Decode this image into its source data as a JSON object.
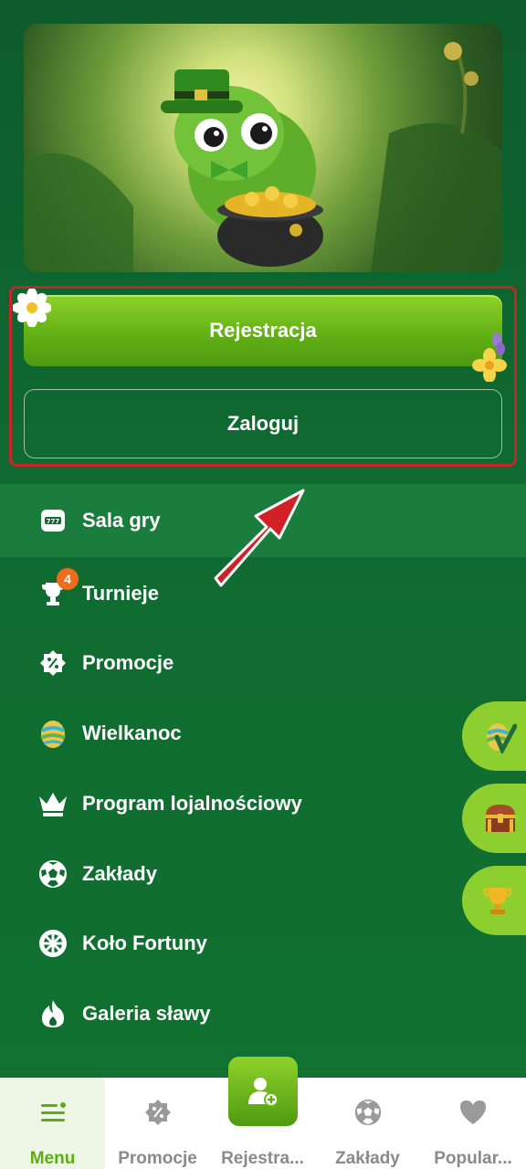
{
  "banner": {
    "alt_icon": "leprechaun-pot-of-gold-banner"
  },
  "auth": {
    "register_label": "Rejestracja",
    "login_label": "Zaloguj"
  },
  "menu": {
    "items": [
      {
        "label": "Sala gry",
        "icon": "slot-machine-icon"
      },
      {
        "label": "Turnieje",
        "icon": "trophy-icon",
        "badge": "4"
      },
      {
        "label": "Promocje",
        "icon": "percent-badge-icon"
      },
      {
        "label": "Wielkanoc",
        "icon": "easter-egg-icon"
      },
      {
        "label": "Program lojalnościowy",
        "icon": "crown-icon"
      },
      {
        "label": "Zakłady",
        "icon": "soccer-ball-icon"
      },
      {
        "label": "Koło Fortuny",
        "icon": "wheel-icon"
      },
      {
        "label": "Galeria sławy",
        "icon": "flame-icon"
      }
    ]
  },
  "side_buttons": [
    "easter-egg-check-icon",
    "treasure-chest-icon",
    "trophy-cup-icon"
  ],
  "bottom_nav": {
    "tabs": [
      {
        "label": "Menu",
        "icon": "menu-icon",
        "active": true
      },
      {
        "label": "Promocje",
        "icon": "percent-badge-icon"
      },
      {
        "label": "Rejestra...",
        "icon": "add-user-icon"
      },
      {
        "label": "Zakłady",
        "icon": "soccer-ball-icon"
      },
      {
        "label": "Popular...",
        "icon": "heart-icon"
      }
    ]
  },
  "colors": {
    "background": "#0f6a31",
    "accent_green": "#6fbf1c",
    "highlight_red": "#c8252b",
    "badge_orange": "#ef6c1a"
  }
}
